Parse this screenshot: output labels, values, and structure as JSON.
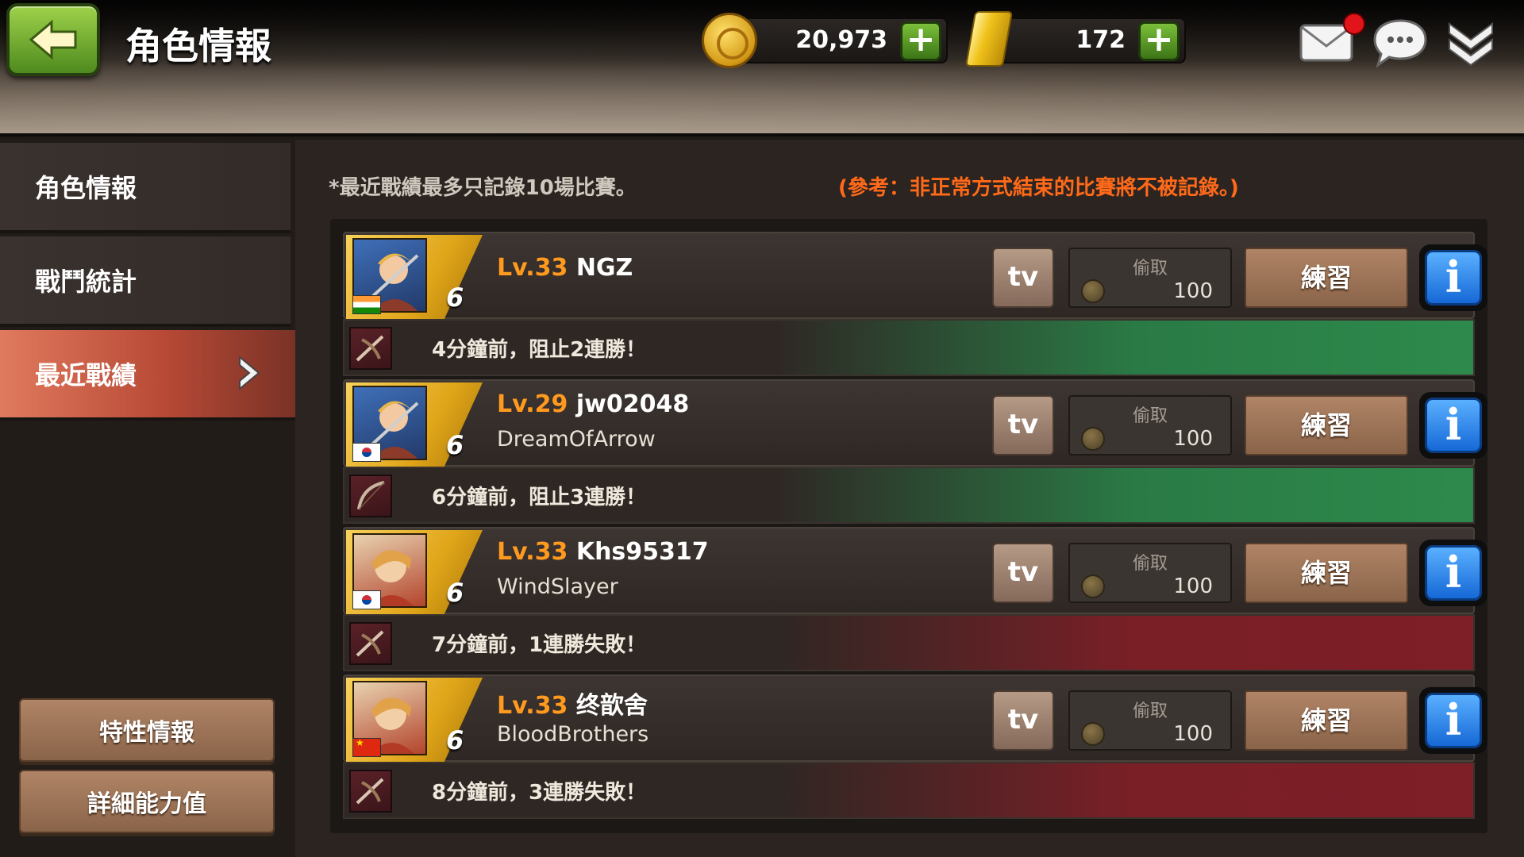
{
  "header": {
    "title": "角色情報",
    "coins": "20,973",
    "gold": "172"
  },
  "sidebar": {
    "items": [
      {
        "label": "角色情報"
      },
      {
        "label": "戰鬥統計"
      },
      {
        "label": "最近戰績"
      }
    ],
    "buttons": [
      {
        "label": "特性情報"
      },
      {
        "label": "詳細能力值"
      }
    ]
  },
  "main": {
    "note": "*最近戰績最多只記錄10場比賽。",
    "reference": "(參考：非正常方式結束的比賽將不被記錄。)",
    "records": [
      {
        "level": "Lv.33",
        "name": "NGZ",
        "guild": "",
        "rank": "6",
        "tv": "tv",
        "steal_label": "偷取",
        "steal_value": "100",
        "practice": "練習",
        "info": "i",
        "result": "4分鐘前，阻止2連勝！",
        "outcome": "win",
        "flag": "in",
        "portrait": "blue"
      },
      {
        "level": "Lv.29",
        "name": "jw02048",
        "guild": "DreamOfArrow",
        "rank": "6",
        "tv": "tv",
        "steal_label": "偷取",
        "steal_value": "100",
        "practice": "練習",
        "info": "i",
        "result": "6分鐘前，阻止3連勝！",
        "outcome": "win",
        "flag": "kr",
        "portrait": "blue"
      },
      {
        "level": "Lv.33",
        "name": "Khs95317",
        "guild": "WindSlayer",
        "rank": "6",
        "tv": "tv",
        "steal_label": "偷取",
        "steal_value": "100",
        "practice": "練習",
        "info": "i",
        "result": "7分鐘前，1連勝失敗！",
        "outcome": "lose",
        "flag": "kr",
        "portrait": "warm"
      },
      {
        "level": "Lv.33",
        "name": "终歆舍",
        "guild": "BloodBrothers",
        "rank": "6",
        "tv": "tv",
        "steal_label": "偷取",
        "steal_value": "100",
        "practice": "練習",
        "info": "i",
        "result": "8分鐘前，3連勝失敗！",
        "outcome": "lose",
        "flag": "cn",
        "portrait": "warm"
      }
    ]
  },
  "colors": {
    "win": "#2d8a4c",
    "lose": "#7e1e27",
    "level": "#ff9a1f",
    "reference": "#ff6a1a",
    "active_tab": "#b84a36"
  }
}
